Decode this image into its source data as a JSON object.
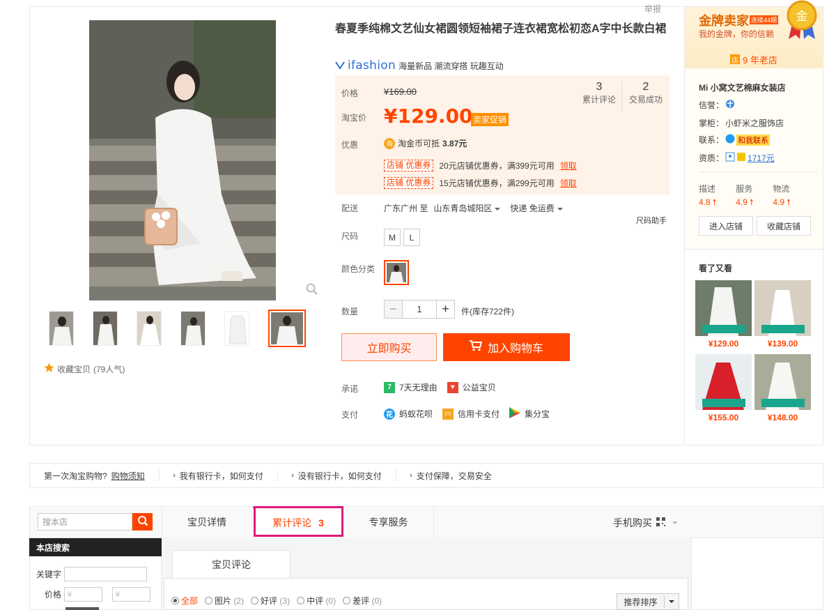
{
  "report_label": "举报",
  "product": {
    "title": "春夏季纯棉文艺仙女裙圆领短袖裙子连衣裙宽松初恋A字中长款白裙",
    "brand": "ifashion",
    "brand_tagline": "海量新品 潮流穿搭 玩趣互动",
    "favorite": "收藏宝贝",
    "favorite_count": "(79人气)"
  },
  "price": {
    "label": "价格",
    "original": "¥169.00",
    "promo_label": "淘宝价",
    "current": "¥129.00",
    "promo_tag": "卖家促销",
    "stats": [
      {
        "num": "3",
        "label": "累计评论"
      },
      {
        "num": "2",
        "label": "交易成功"
      }
    ],
    "discount_label": "优惠",
    "coin_text": "淘金币可抵",
    "coin_amount": "3.87元",
    "coupons": [
      {
        "tag": "店铺 优惠券",
        "text": "20元店铺优惠券，满399元可用",
        "link": "领取"
      },
      {
        "tag": "店铺 优惠券",
        "text": "15元店铺优惠券，满299元可用",
        "link": "领取"
      }
    ]
  },
  "delivery": {
    "label": "配送",
    "from": "广东广州 至",
    "to": "山东青岛城阳区",
    "method": "快递 免运费",
    "size_helper": "尺码助手"
  },
  "size": {
    "label": "尺码",
    "options": [
      "M",
      "L"
    ]
  },
  "color": {
    "label": "颜色分类"
  },
  "quantity": {
    "label": "数量",
    "value": "1",
    "stock": "件(库存722件)"
  },
  "actions": {
    "buy_now": "立即购买",
    "add_cart": "加入购物车"
  },
  "promise": {
    "label": "承诺",
    "items": [
      "7天无理由",
      "公益宝贝"
    ]
  },
  "payment": {
    "label": "支付",
    "items": [
      "蚂蚁花呗",
      "信用卡支付",
      "集分宝"
    ]
  },
  "seller": {
    "badge_title": "金牌卖家",
    "badge_years": "连续44期",
    "badge_sub": "我的金牌，你的信赖",
    "medal_char": "金",
    "old_shop": "9 年老店",
    "shop_icon_char": "店",
    "shop_name": "Mi 小窝文艺棉麻女装店",
    "credit_label": "信誉：",
    "keeper_label": "掌柜：",
    "keeper": "小虾米之服饰店",
    "contact_label": "联系：",
    "contact_btn": "和我联系",
    "qual_label": "资质：",
    "qual_amount": "1717元",
    "ratings": [
      {
        "label": "描述",
        "value": "4.8"
      },
      {
        "label": "服务",
        "value": "4.9"
      },
      {
        "label": "物流",
        "value": "4.9"
      }
    ],
    "enter_shop": "进入店铺",
    "collect_shop": "收藏店铺",
    "also_viewed": "看了又看",
    "recommend_prices": [
      "¥129.00",
      "¥139.00",
      "¥155.00",
      "¥148.00"
    ]
  },
  "tips": {
    "first": "第一次淘宝购物?",
    "first_link": "购物须知",
    "items": [
      "我有银行卡，如何支付",
      "没有银行卡，如何支付",
      "支付保障，交易安全"
    ]
  },
  "bottom": {
    "search_placeholder": "搜本店",
    "store_search": "本店搜索",
    "keyword_label": "关键字",
    "price_label": "价格",
    "price_placeholder": "¥",
    "tabs": [
      "宝贝详情",
      "累计评论",
      "专享服务"
    ],
    "review_count": "3",
    "mobile_buy": "手机购买",
    "review_tab": "宝贝评论",
    "filters": [
      {
        "label": "全部",
        "count": ""
      },
      {
        "label": "图片",
        "count": "(2)"
      },
      {
        "label": "好评",
        "count": "(3)"
      },
      {
        "label": "中评",
        "count": "(0)"
      },
      {
        "label": "差评",
        "count": "(0)"
      }
    ],
    "sort": "推荐排序"
  },
  "colors": {
    "accent": "#ff4400",
    "highlight": "#e0197a",
    "gold": "#e06800"
  }
}
